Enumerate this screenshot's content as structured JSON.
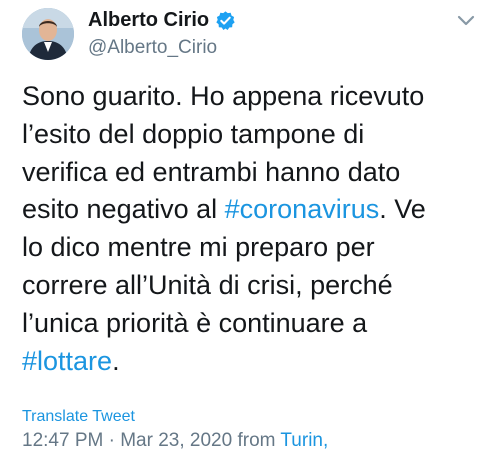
{
  "author": {
    "name": "Alberto Cirio",
    "handle": "@Alberto_Cirio"
  },
  "icons": {
    "verified": "verified-badge-icon",
    "more": "chevron-down-icon"
  },
  "colors": {
    "link": "#1b95e0",
    "verified": "#1da1f2",
    "muted": "#657786",
    "text": "#14171a"
  },
  "tweet": {
    "lines": [
      [
        {
          "text": "Sono guarito. Ho appena ricevuto"
        }
      ],
      [
        {
          "text": "l’esito del doppio tampone di"
        }
      ],
      [
        {
          "text": "verifica ed entrambi hanno dato"
        }
      ],
      [
        {
          "text": "esito negativo al "
        },
        {
          "text": "#coronavirus",
          "hashtag": true
        },
        {
          "text": ". Ve"
        }
      ],
      [
        {
          "text": "lo dico mentre mi preparo per"
        }
      ],
      [
        {
          "text": "correre all’Unità di crisi, perché"
        }
      ],
      [
        {
          "text": "l’unica priorità è continuare a"
        }
      ],
      [
        {
          "text": "#lottare",
          "hashtag": true
        },
        {
          "text": "."
        }
      ]
    ]
  },
  "translate_label": "Translate Tweet",
  "meta": {
    "time": "12:47 PM",
    "separator": " · ",
    "date": "Mar 23, 2020",
    "from_label": " from ",
    "place": "Turin,"
  }
}
